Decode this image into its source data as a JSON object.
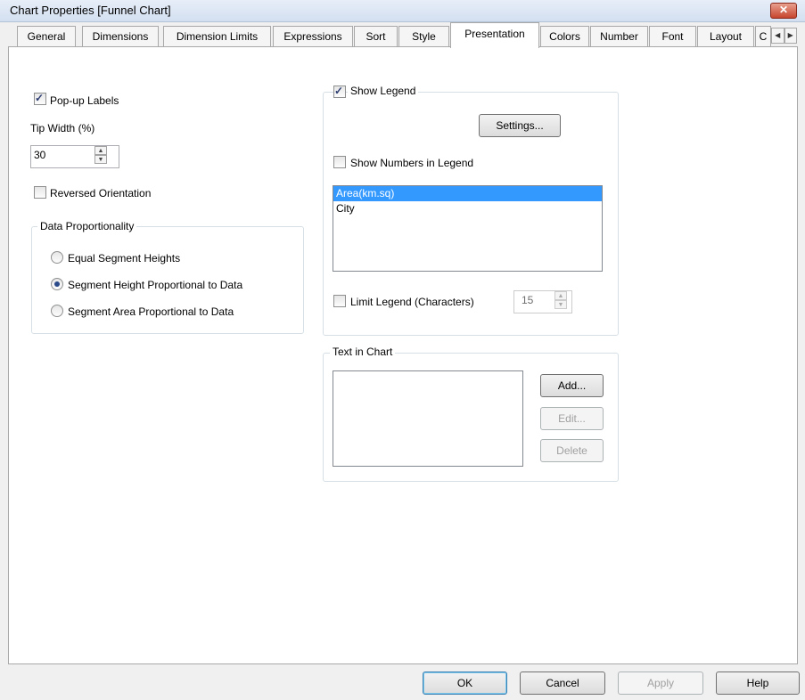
{
  "window": {
    "title": "Chart Properties [Funnel Chart]",
    "close_glyph": "✕"
  },
  "tabs": [
    {
      "label": "General"
    },
    {
      "label": "Dimensions"
    },
    {
      "label": "Dimension Limits"
    },
    {
      "label": "Expressions"
    },
    {
      "label": "Sort"
    },
    {
      "label": "Style"
    },
    {
      "label": "Presentation"
    },
    {
      "label": "Colors"
    },
    {
      "label": "Number"
    },
    {
      "label": "Font"
    },
    {
      "label": "Layout"
    },
    {
      "label": "C"
    }
  ],
  "active_tab": "Presentation",
  "left": {
    "popup_labels": {
      "label": "Pop-up Labels",
      "checked": true
    },
    "tip_width": {
      "label": "Tip Width (%)",
      "value": "30"
    },
    "reversed_orientation": {
      "label": "Reversed Orientation",
      "checked": false
    },
    "data_proportionality": {
      "title": "Data Proportionality",
      "options": [
        {
          "label": "Equal Segment Heights",
          "checked": false
        },
        {
          "label": "Segment Height Proportional to Data",
          "checked": true
        },
        {
          "label": "Segment Area Proportional to Data",
          "checked": false
        }
      ]
    }
  },
  "legend": {
    "show_legend": {
      "label": "Show Legend",
      "checked": true
    },
    "settings_button": "Settings...",
    "show_numbers": {
      "label": "Show Numbers in Legend",
      "checked": false
    },
    "items": [
      {
        "label": "Area(km.sq)",
        "selected": true
      },
      {
        "label": "City",
        "selected": false
      }
    ],
    "limit_legend": {
      "label": "Limit Legend (Characters)",
      "checked": false,
      "value": "15"
    }
  },
  "text_in_chart": {
    "title": "Text in Chart",
    "add_button": "Add...",
    "edit_button": "Edit...",
    "delete_button": "Delete"
  },
  "footer": {
    "ok": "OK",
    "cancel": "Cancel",
    "apply": "Apply",
    "help": "Help"
  }
}
